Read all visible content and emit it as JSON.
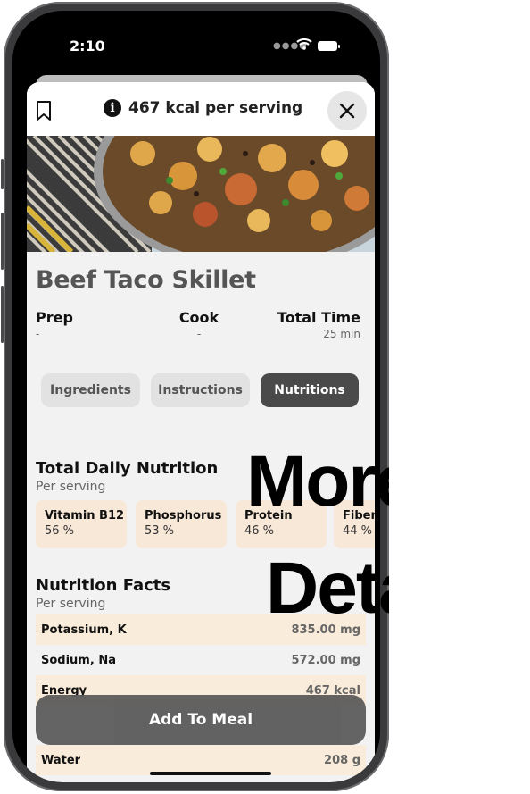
{
  "status_bar": {
    "time": "2:10"
  },
  "header": {
    "kcal_text": "467 kcal per serving"
  },
  "recipe": {
    "title": "Beef Taco Skillet",
    "meta": [
      {
        "label": "Prep",
        "value": "-"
      },
      {
        "label": "Cook",
        "value": "-"
      },
      {
        "label": "Total Time",
        "value": "25 min"
      }
    ]
  },
  "tabs": [
    {
      "label": "Ingredients",
      "active": false
    },
    {
      "label": "Instructions",
      "active": false
    },
    {
      "label": "Nutritions",
      "active": true
    }
  ],
  "daily": {
    "title": "Total Daily Nutrition",
    "subtitle": "Per serving",
    "cards": [
      {
        "name": "Vitamin B12",
        "percent": "56 %"
      },
      {
        "name": "Phosphorus",
        "percent": "53 %"
      },
      {
        "name": "Protein",
        "percent": "46 %"
      },
      {
        "name": "Fiber",
        "percent": "44 %"
      }
    ]
  },
  "facts": {
    "title": "Nutrition Facts",
    "subtitle": "Per serving",
    "rows": [
      {
        "name": "Potassium, K",
        "amount": "835.00 mg"
      },
      {
        "name": "Sodium, Na",
        "amount": "572.00 mg"
      },
      {
        "name": "Energy",
        "amount": "467 kcal"
      }
    ],
    "water": {
      "name": "Water",
      "amount": "208 g"
    }
  },
  "add_button": {
    "label": "Add To Meal"
  },
  "overlay_text": {
    "line1": "More",
    "line2": "Details"
  },
  "colors": {
    "card_bg": "#f8e8d8",
    "row_shade": "#faecda",
    "active_tab": "#4a4a4a"
  }
}
